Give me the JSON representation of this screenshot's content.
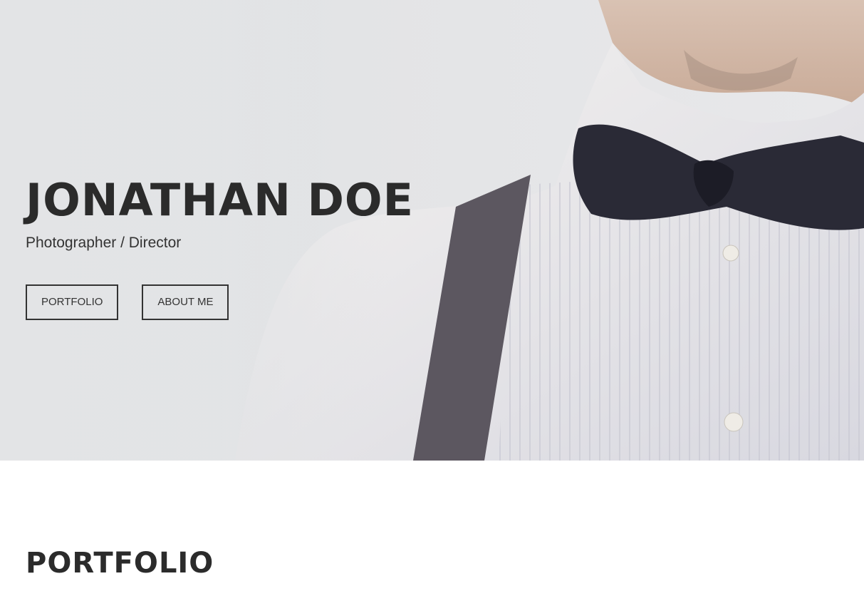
{
  "hero": {
    "title": "JONATHAN DOE",
    "subtitle": "Photographer / Director",
    "buttons": {
      "portfolio": "PORTFOLIO",
      "about": "ABOUT ME"
    }
  },
  "portfolio_section": {
    "title": "PORTFOLIO"
  },
  "colors": {
    "text": "#2b2b2b",
    "background": "#ffffff",
    "hero_background": "#e3e4e6"
  }
}
